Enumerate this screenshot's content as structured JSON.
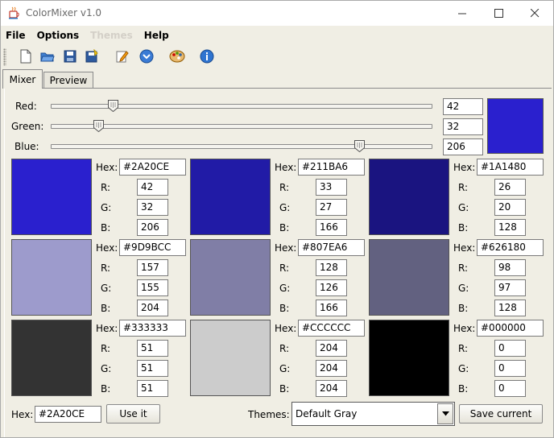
{
  "window": {
    "title": "ColorMixer v1.0"
  },
  "menu": [
    {
      "label": "File",
      "enabled": true
    },
    {
      "label": "Options",
      "enabled": true
    },
    {
      "label": "Themes",
      "enabled": false
    },
    {
      "label": "Help",
      "enabled": true
    }
  ],
  "toolbar": {
    "icons": [
      "new-file-icon",
      "open-folder-icon",
      "save-icon",
      "save-all-icon",
      "edit-icon",
      "download-icon",
      "palette-icon",
      "info-icon"
    ]
  },
  "tabs": [
    {
      "label": "Mixer",
      "active": true
    },
    {
      "label": "Preview",
      "active": false
    }
  ],
  "sliders": [
    {
      "label": "Red:",
      "value": "42",
      "fraction": 0.1647
    },
    {
      "label": "Green:",
      "value": "32",
      "fraction": 0.1255
    },
    {
      "label": "Blue:",
      "value": "206",
      "fraction": 0.8078
    }
  ],
  "preview_color": "#2A20CE",
  "swatches": [
    {
      "hex": "#2A20CE",
      "r": "42",
      "g": "32",
      "b": "206",
      "color": "#2A20CE"
    },
    {
      "hex": "#211BA6",
      "r": "33",
      "g": "27",
      "b": "166",
      "color": "#211BA6"
    },
    {
      "hex": "#1A1480",
      "r": "26",
      "g": "20",
      "b": "128",
      "color": "#1A1480"
    },
    {
      "hex": "#9D9BCC",
      "r": "157",
      "g": "155",
      "b": "204",
      "color": "#9D9BCC"
    },
    {
      "hex": "#807EA6",
      "r": "128",
      "g": "126",
      "b": "166",
      "color": "#807EA6"
    },
    {
      "hex": "#626180",
      "r": "98",
      "g": "97",
      "b": "128",
      "color": "#626180"
    },
    {
      "hex": "#333333",
      "r": "51",
      "g": "51",
      "b": "51",
      "color": "#333333"
    },
    {
      "hex": "#CCCCCC",
      "r": "204",
      "g": "204",
      "b": "204",
      "color": "#CCCCCC"
    },
    {
      "hex": "#000000",
      "r": "0",
      "g": "0",
      "b": "0",
      "color": "#000000"
    }
  ],
  "labels": {
    "hex": "Hex:",
    "r": "R:",
    "g": "G:",
    "b": "B:"
  },
  "bottom": {
    "hex_label": "Hex:",
    "hex_value": "#2A20CE",
    "use_button": "Use it",
    "themes_label": "Themes:",
    "theme_selected": "Default Gray",
    "save_button": "Save current"
  }
}
